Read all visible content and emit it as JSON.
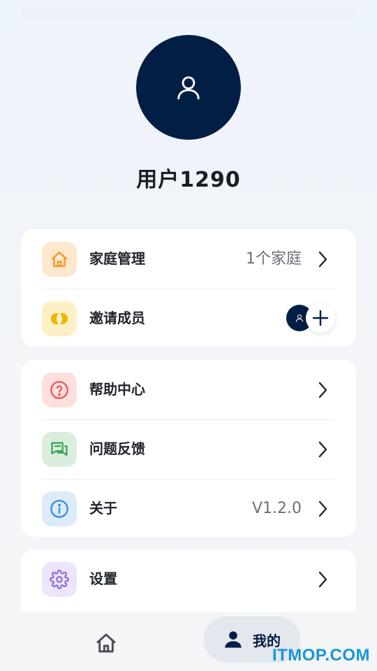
{
  "profile": {
    "username": "用户1290",
    "avatar_icon": "user-outline-icon"
  },
  "family_card": {
    "family_management": {
      "label": "家庭管理",
      "value": "1个家庭",
      "icon": "home-icon",
      "color": "#f59a23"
    },
    "invite_members": {
      "label": "邀请成员",
      "icon": "coins-icon",
      "color": "#f5b400",
      "action_icon": "plus-icon"
    }
  },
  "support_card": {
    "help_center": {
      "label": "帮助中心",
      "icon": "help-circle-icon",
      "color": "#ef5a5a"
    },
    "feedback": {
      "label": "问题反馈",
      "icon": "chat-icon",
      "color": "#3fa65a"
    },
    "about": {
      "label": "关于",
      "value": "V1.2.0",
      "icon": "info-icon",
      "color": "#3c8de0"
    }
  },
  "settings_card": {
    "settings": {
      "label": "设置",
      "icon": "gear-icon",
      "color": "#8a6ce0"
    }
  },
  "tabbar": {
    "home_icon": "home-tab-icon",
    "mine_label": "我的",
    "accent": "#031e44"
  },
  "watermark": "ITMOP.COM"
}
